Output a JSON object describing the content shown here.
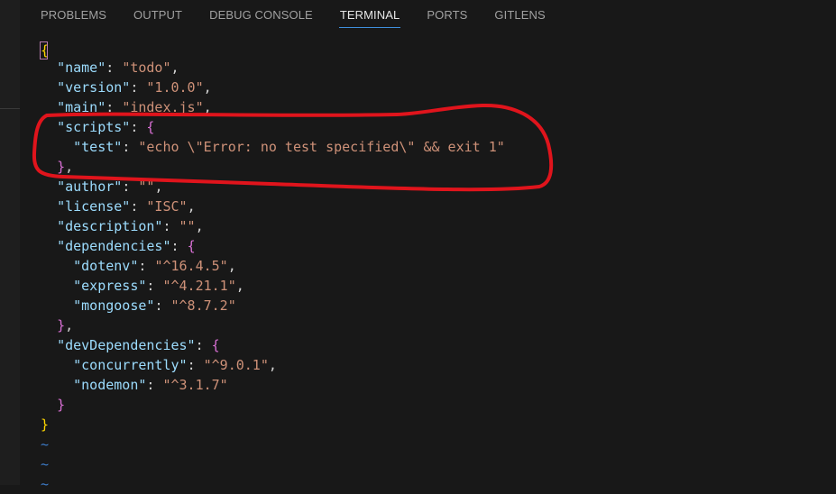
{
  "panel": {
    "tabs": [
      {
        "label": "PROBLEMS"
      },
      {
        "label": "OUTPUT"
      },
      {
        "label": "DEBUG CONSOLE"
      },
      {
        "label": "TERMINAL"
      },
      {
        "label": "PORTS"
      },
      {
        "label": "GITLENS"
      }
    ],
    "active_tab": "TERMINAL"
  },
  "terminal": {
    "open_brace": "{",
    "name_key": "\"name\"",
    "name_val": "\"todo\"",
    "version_key": "\"version\"",
    "version_val": "\"1.0.0\"",
    "main_key": "\"main\"",
    "main_val": "\"index.js\"",
    "scripts_key": "\"scripts\"",
    "test_key": "\"test\"",
    "test_val": "\"echo \\\"Error: no test specified\\\" && exit 1\"",
    "author_key": "\"author\"",
    "author_val": "\"\"",
    "license_key": "\"license\"",
    "license_val": "\"ISC\"",
    "description_key": "\"description\"",
    "description_val": "\"\"",
    "dependencies_key": "\"dependencies\"",
    "dotenv_key": "\"dotenv\"",
    "dotenv_val": "\"^16.4.5\"",
    "express_key": "\"express\"",
    "express_val": "\"^4.21.1\"",
    "mongoose_key": "\"mongoose\"",
    "mongoose_val": "\"^8.7.2\"",
    "devDependencies_key": "\"devDependencies\"",
    "concurrently_key": "\"concurrently\"",
    "concurrently_val": "\"^9.0.1\"",
    "nodemon_key": "\"nodemon\"",
    "nodemon_val": "\"^3.1.7\"",
    "close_brace": "}",
    "tilde": "~"
  },
  "colors": {
    "annotation": "#e0141c",
    "key": "#9cdcfe",
    "string": "#ce9178",
    "active_tab_underline": "#3f8fdc"
  }
}
